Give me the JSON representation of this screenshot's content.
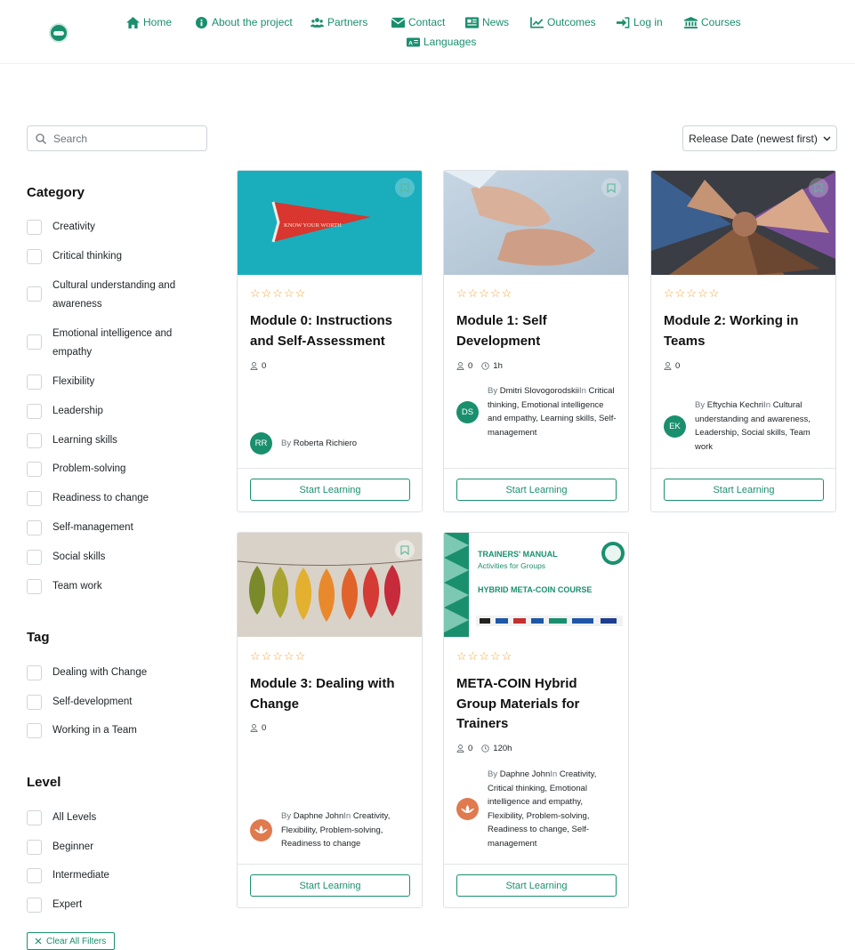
{
  "nav": {
    "items": [
      {
        "label": "Home",
        "icon": "home-icon"
      },
      {
        "label": "About the project",
        "icon": "info-icon"
      },
      {
        "label": "Partners",
        "icon": "users-icon"
      },
      {
        "label": "Contact",
        "icon": "envelope-icon"
      },
      {
        "label": "News",
        "icon": "newspaper-icon"
      },
      {
        "label": "Outcomes",
        "icon": "chart-line-icon"
      },
      {
        "label": "Log in",
        "icon": "sign-in-icon"
      },
      {
        "label": "Courses",
        "icon": "university-icon"
      },
      {
        "label": "Languages",
        "icon": "language-icon"
      }
    ]
  },
  "search": {
    "placeholder": "Search"
  },
  "sort": {
    "selected": "Release Date (newest first)"
  },
  "sidebar": {
    "category": {
      "title": "Category",
      "items": [
        "Creativity",
        "Critical thinking",
        "Cultural understanding and awareness",
        "Emotional intelligence and empathy",
        "Flexibility",
        "Leadership",
        "Learning skills",
        "Problem-solving",
        "Readiness to change",
        "Self-management",
        "Social skills",
        "Team work"
      ]
    },
    "tag": {
      "title": "Tag",
      "items": [
        "Dealing with Change",
        "Self-development",
        "Working in a Team"
      ]
    },
    "level": {
      "title": "Level",
      "items": [
        "All Levels",
        "Beginner",
        "Intermediate",
        "Expert"
      ]
    },
    "clear_label": "Clear All Filters"
  },
  "courses": [
    {
      "stars": "☆☆☆☆☆",
      "title": "Module 0: Instructions and Self-Assessment",
      "students": "0",
      "duration": "",
      "avatar": "RR",
      "by": "By",
      "author": "Roberta Richiero",
      "in": "",
      "categories": "",
      "button": "Start Learning",
      "image_text": "KNOW YOUR WORTH"
    },
    {
      "stars": "☆☆☆☆☆",
      "title": "Module 1: Self Development",
      "students": "0",
      "duration": "1h",
      "avatar": "DS",
      "by": "By",
      "author": "Dmitri Slovogorodskii",
      "in": "In",
      "categories": "Critical thinking, Emotional intelligence and empathy, Learning skills, Self-management",
      "button": "Start Learning"
    },
    {
      "stars": "☆☆☆☆☆",
      "title": "Module 2: Working in Teams",
      "students": "0",
      "duration": "",
      "avatar": "EK",
      "by": "By",
      "author": "Eftychia Kechri",
      "in": "In",
      "categories": "Cultural understanding and awareness, Leadership, Social skills, Team work",
      "button": "Start Learning"
    },
    {
      "stars": "☆☆☆☆☆",
      "title": "Module 3: Dealing with Change",
      "students": "0",
      "duration": "",
      "avatar": "",
      "by": "By",
      "author": "Daphne John",
      "in": "In",
      "categories": "Creativity, Flexibility, Problem-solving, Readiness to change",
      "button": "Start Learning"
    },
    {
      "stars": "☆☆☆☆☆",
      "title": "META-COIN Hybrid Group Materials for Trainers",
      "students": "0",
      "duration": "120h",
      "avatar": "",
      "by": "By",
      "author": "Daphne John",
      "in": "In",
      "categories": "Creativity, Critical thinking, Emotional intelligence and empathy, Flexibility, Problem-solving, Readiness to change, Self-management",
      "button": "Start Learning",
      "image_text": {
        "line1": "TRAINERS' MANUAL",
        "line2": "Activities for Groups",
        "line3": "HYBRID META-COIN COURSE"
      }
    }
  ],
  "colors": {
    "accent": "#1a8f6e",
    "star": "#f2a53c",
    "avatar_orange": "#e07a4f"
  }
}
